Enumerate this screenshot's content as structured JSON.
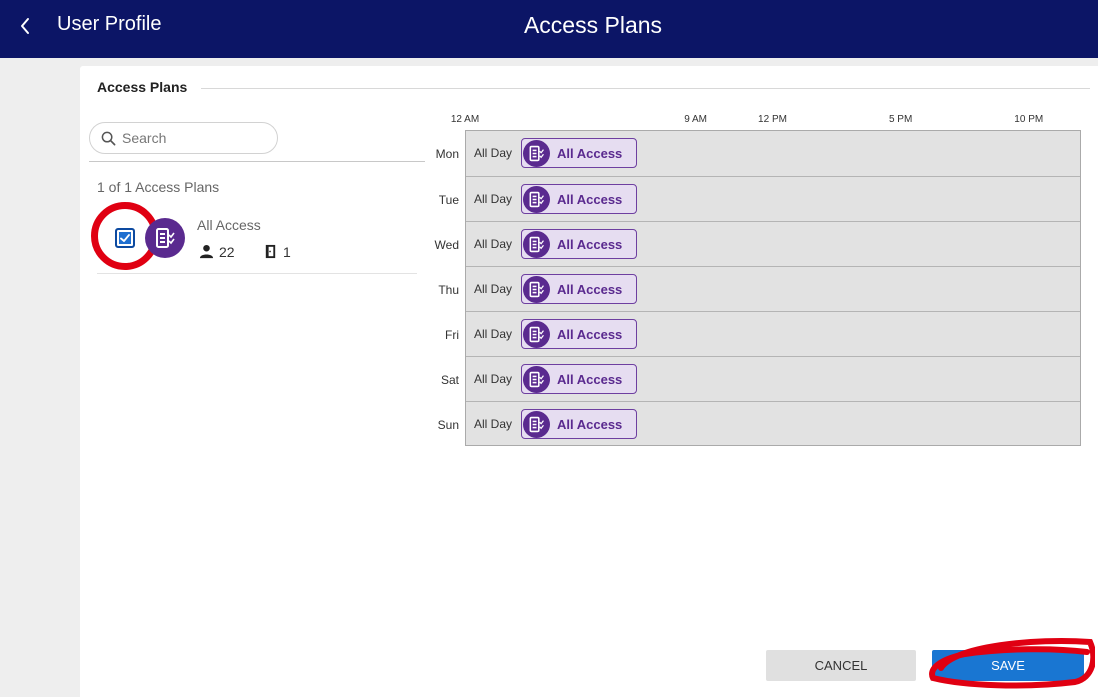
{
  "header": {
    "back_label": "User Profile",
    "title": "Access Plans"
  },
  "panel": {
    "title": "Access Plans",
    "search_placeholder": "Search",
    "count_text": "1 of 1 Access Plans"
  },
  "plan": {
    "name": "All Access",
    "checked": true,
    "users_count": "22",
    "doors_count": "1"
  },
  "schedule": {
    "hours": [
      {
        "label": "12 AM",
        "hour": 0
      },
      {
        "label": "9 AM",
        "hour": 9
      },
      {
        "label": "12 PM",
        "hour": 12
      },
      {
        "label": "5 PM",
        "hour": 17
      },
      {
        "label": "10 PM",
        "hour": 22
      }
    ],
    "days": [
      {
        "day": "Mon",
        "time": "All Day",
        "plan": "All Access"
      },
      {
        "day": "Tue",
        "time": "All Day",
        "plan": "All Access"
      },
      {
        "day": "Wed",
        "time": "All Day",
        "plan": "All Access"
      },
      {
        "day": "Thu",
        "time": "All Day",
        "plan": "All Access"
      },
      {
        "day": "Fri",
        "time": "All Day",
        "plan": "All Access"
      },
      {
        "day": "Sat",
        "time": "All Day",
        "plan": "All Access"
      },
      {
        "day": "Sun",
        "time": "All Day",
        "plan": "All Access"
      }
    ]
  },
  "actions": {
    "cancel_label": "CANCEL",
    "save_label": "SAVE"
  },
  "colors": {
    "header_bg": "#0c1566",
    "plan_purple": "#5a2a8f",
    "save_blue": "#1976d2",
    "annotation_red": "#e00012"
  }
}
